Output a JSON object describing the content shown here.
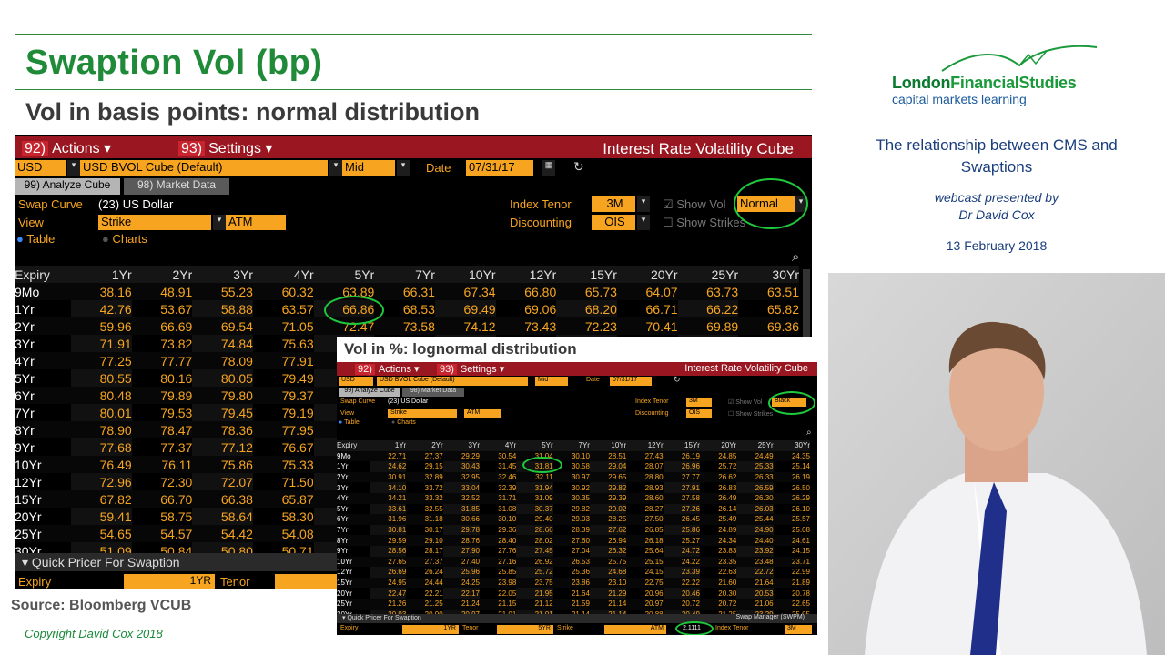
{
  "slide": {
    "title": "Swaption Vol (bp)",
    "subtitle": "Vol in basis points: normal distribution",
    "source": "Source: Bloomberg VCUB",
    "copyright": "Copyright David Cox 2018"
  },
  "brand": {
    "name_a": "London",
    "name_b": "FinancialStudies",
    "tagline": "capital markets learning",
    "green": "#1a9a3a",
    "blue": "#1a5a9a"
  },
  "talk": {
    "title": "The relationship between CMS and Swaptions",
    "presented_by": "webcast presented by",
    "presenter": "Dr David Cox",
    "date": "13 February 2018"
  },
  "main": {
    "actions": "Actions",
    "actions_num": "92)",
    "settings": "Settings",
    "settings_num": "93)",
    "window_title": "Interest Rate Volatility Cube",
    "currency": "USD",
    "cube": "USD BVOL Cube (Default)",
    "side": "Mid",
    "date_label": "Date",
    "date": "07/31/17",
    "tab1_num": "99)",
    "tab1": "Analyze Cube",
    "tab2_num": "98)",
    "tab2": "Market Data",
    "swap_curve_label": "Swap Curve",
    "swap_curve": "(23) US Dollar",
    "view_label": "View",
    "view": "Strike",
    "view2": "ATM",
    "table_label": "Table",
    "charts_label": "Charts",
    "index_tenor_label": "Index Tenor",
    "index_tenor": "3M",
    "discounting_label": "Discounting",
    "discounting": "OIS",
    "show_vol_label": "Show Vol",
    "show_vol": "Normal",
    "show_strikes_label": "Show Strikes",
    "quick_pricer": "Quick Pricer For Swaption",
    "qp_expiry": "Expiry",
    "qp_expiry_val": "1YR",
    "qp_tenor": "Tenor",
    "columns": [
      "Expiry",
      "1Yr",
      "2Yr",
      "3Yr",
      "4Yr",
      "5Yr",
      "7Yr",
      "10Yr",
      "12Yr",
      "15Yr",
      "20Yr",
      "25Yr",
      "30Yr"
    ],
    "rows": [
      [
        "9Mo",
        "38.16",
        "48.91",
        "55.23",
        "60.32",
        "63.89",
        "66.31",
        "67.34",
        "66.80",
        "65.73",
        "64.07",
        "63.73",
        "63.51"
      ],
      [
        "1Yr",
        "42.76",
        "53.67",
        "58.88",
        "63.57",
        "66.86",
        "68.53",
        "69.49",
        "69.06",
        "68.20",
        "66.71",
        "66.22",
        "65.82"
      ],
      [
        "2Yr",
        "59.96",
        "66.69",
        "69.54",
        "71.05",
        "72.47",
        "73.58",
        "74.12",
        "73.43",
        "72.23",
        "70.41",
        "69.89",
        "69.36"
      ],
      [
        "3Yr",
        "71.91",
        "73.82",
        "74.84",
        "75.63",
        "",
        "",
        "",
        "",
        "",
        "",
        "",
        ""
      ],
      [
        "4Yr",
        "77.25",
        "77.77",
        "78.09",
        "77.91",
        "",
        "",
        "",
        "",
        "",
        "",
        "",
        ""
      ],
      [
        "5Yr",
        "80.55",
        "80.16",
        "80.05",
        "79.49",
        "",
        "",
        "",
        "",
        "",
        "",
        "",
        ""
      ],
      [
        "6Yr",
        "80.48",
        "79.89",
        "79.80",
        "79.37",
        "",
        "",
        "",
        "",
        "",
        "",
        "",
        ""
      ],
      [
        "7Yr",
        "80.01",
        "79.53",
        "79.45",
        "79.19",
        "",
        "",
        "",
        "",
        "",
        "",
        "",
        ""
      ],
      [
        "8Yr",
        "78.90",
        "78.47",
        "78.36",
        "77.95",
        "",
        "",
        "",
        "",
        "",
        "",
        "",
        ""
      ],
      [
        "9Yr",
        "77.68",
        "77.37",
        "77.12",
        "76.67",
        "",
        "",
        "",
        "",
        "",
        "",
        "",
        ""
      ],
      [
        "10Yr",
        "76.49",
        "76.11",
        "75.86",
        "75.33",
        "",
        "",
        "",
        "",
        "",
        "",
        "",
        ""
      ],
      [
        "12Yr",
        "72.96",
        "72.30",
        "72.07",
        "71.50",
        "",
        "",
        "",
        "",
        "",
        "",
        "",
        ""
      ],
      [
        "15Yr",
        "67.82",
        "66.70",
        "66.38",
        "65.87",
        "",
        "",
        "",
        "",
        "",
        "",
        "",
        ""
      ],
      [
        "20Yr",
        "59.41",
        "58.75",
        "58.64",
        "58.30",
        "",
        "",
        "",
        "",
        "",
        "",
        "",
        ""
      ],
      [
        "25Yr",
        "54.65",
        "54.57",
        "54.42",
        "54.08",
        "",
        "",
        "",
        "",
        "",
        "",
        "",
        ""
      ],
      [
        "30Yr",
        "51.09",
        "50.84",
        "50.80",
        "50.71",
        "",
        "",
        "",
        "",
        "",
        "",
        "",
        ""
      ]
    ]
  },
  "inset": {
    "caption": "Vol in %: lognormal distribution",
    "actions": "Actions",
    "actions_num": "92)",
    "settings": "Settings",
    "settings_num": "93)",
    "window_title": "Interest Rate Volatility Cube",
    "currency": "USD",
    "cube": "USD BVOL Cube (Default)",
    "side": "Mid",
    "date_label": "Date",
    "date": "07/31/17",
    "tab1_num": "99)",
    "tab1": "Analyze Cube",
    "tab2_num": "98)",
    "tab2": "Market Data",
    "swap_curve_label": "Swap Curve",
    "swap_curve": "(23) US Dollar",
    "view_label": "View",
    "view": "Strike",
    "view2": "ATM",
    "table_label": "Table",
    "charts_label": "Charts",
    "index_tenor_label": "Index Tenor",
    "index_tenor": "3M",
    "discounting_label": "Discounting",
    "discounting": "OIS",
    "show_vol_label": "Show Vol",
    "show_vol": "Black",
    "show_strikes_label": "Show Strikes",
    "quick_pricer": "Quick Pricer For Swaption",
    "swap_manager": "Swap Manager (SWPM)",
    "qp_expiry": "Expiry",
    "qp_expiry_val": "1YR",
    "qp_tenor": "Tenor",
    "qp_tenor_val": "5YR",
    "qp_strike": "Strike",
    "qp_strike_val": "ATM",
    "qp_vol": "2.1111",
    "qp_index_tenor": "Index Tenor",
    "qp_index_tenor_val": "3M",
    "columns": [
      "Expiry",
      "1Yr",
      "2Yr",
      "3Yr",
      "4Yr",
      "5Yr",
      "7Yr",
      "10Yr",
      "12Yr",
      "15Yr",
      "20Yr",
      "25Yr",
      "30Yr"
    ],
    "rows": [
      [
        "9Mo",
        "22.71",
        "27.37",
        "29.29",
        "30.54",
        "31.04",
        "30.10",
        "28.51",
        "27.43",
        "26.19",
        "24.85",
        "24.49",
        "24.35"
      ],
      [
        "1Yr",
        "24.62",
        "29.15",
        "30.43",
        "31.45",
        "31.81",
        "30.58",
        "29.04",
        "28.07",
        "26.96",
        "25.72",
        "25.33",
        "25.14"
      ],
      [
        "2Yr",
        "30.91",
        "32.89",
        "32.95",
        "32.46",
        "32.11",
        "30.97",
        "29.65",
        "28.80",
        "27.77",
        "26.62",
        "26.33",
        "26.19"
      ],
      [
        "3Yr",
        "34.10",
        "33.72",
        "33.04",
        "32.39",
        "31.94",
        "30.92",
        "29.82",
        "28.93",
        "27.91",
        "26.83",
        "26.59",
        "26.50"
      ],
      [
        "4Yr",
        "34.21",
        "33.32",
        "32.52",
        "31.71",
        "31.09",
        "30.35",
        "29.39",
        "28.60",
        "27.58",
        "26.49",
        "26.30",
        "26.29"
      ],
      [
        "5Yr",
        "33.61",
        "32.55",
        "31.85",
        "31.08",
        "30.37",
        "29.82",
        "29.02",
        "28.27",
        "27.26",
        "26.14",
        "26.03",
        "26.10"
      ],
      [
        "6Yr",
        "31.96",
        "31.18",
        "30.66",
        "30.10",
        "29.40",
        "29.03",
        "28.25",
        "27.50",
        "26.45",
        "25.49",
        "25.44",
        "25.57"
      ],
      [
        "7Yr",
        "30.81",
        "30.17",
        "29.78",
        "29.36",
        "28.66",
        "28.39",
        "27.62",
        "26.85",
        "25.86",
        "24.89",
        "24.90",
        "25.08"
      ],
      [
        "8Yr",
        "29.59",
        "29.10",
        "28.76",
        "28.40",
        "28.02",
        "27.60",
        "26.94",
        "26.18",
        "25.27",
        "24.34",
        "24.40",
        "24.61"
      ],
      [
        "9Yr",
        "28.56",
        "28.17",
        "27.90",
        "27.76",
        "27.45",
        "27.04",
        "26.32",
        "25.64",
        "24.72",
        "23.83",
        "23.92",
        "24.15"
      ],
      [
        "10Yr",
        "27.65",
        "27.37",
        "27.40",
        "27.16",
        "26.92",
        "26.53",
        "25.75",
        "25.15",
        "24.22",
        "23.35",
        "23.48",
        "23.71"
      ],
      [
        "12Yr",
        "26.69",
        "26.24",
        "25.96",
        "25.85",
        "25.72",
        "25.36",
        "24.68",
        "24.15",
        "23.39",
        "22.63",
        "22.72",
        "22.99"
      ],
      [
        "15Yr",
        "24.95",
        "24.44",
        "24.25",
        "23.98",
        "23.75",
        "23.86",
        "23.10",
        "22.75",
        "22.22",
        "21.60",
        "21.64",
        "21.89"
      ],
      [
        "20Yr",
        "22.47",
        "22.21",
        "22.17",
        "22.05",
        "21.95",
        "21.64",
        "21.29",
        "20.96",
        "20.46",
        "20.30",
        "20.53",
        "20.78"
      ],
      [
        "25Yr",
        "21.26",
        "21.25",
        "21.24",
        "21.15",
        "21.12",
        "21.59",
        "21.14",
        "20.97",
        "20.72",
        "20.72",
        "21.06",
        "22.65"
      ],
      [
        "30Yr",
        "20.93",
        "20.90",
        "20.97",
        "21.01",
        "21.01",
        "21.14",
        "21.14",
        "20.88",
        "20.49",
        "21.25",
        "23.29",
        "25.05"
      ]
    ]
  }
}
